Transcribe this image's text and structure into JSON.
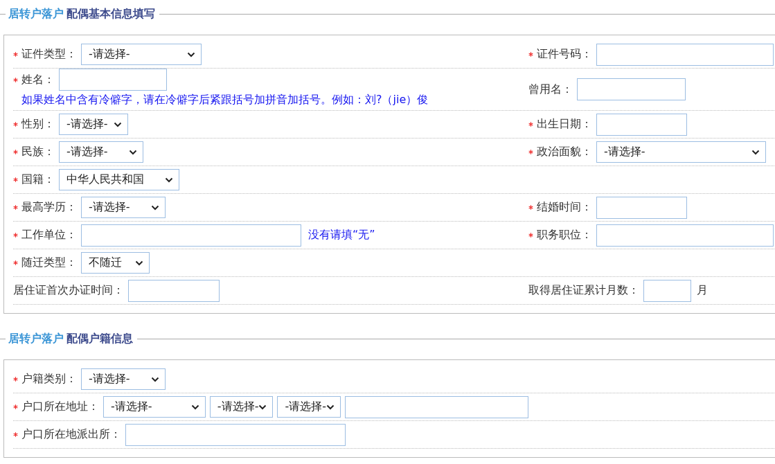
{
  "sections": [
    {
      "prefix": "居转户落户",
      "title": "配偶基本信息填写",
      "rows": [
        {
          "left": {
            "required": true,
            "label": "证件类型：",
            "controls": [
              {
                "kind": "select",
                "value": "-请选择-"
              }
            ]
          },
          "right": {
            "required": true,
            "label": "证件号码：",
            "controls": [
              {
                "kind": "input"
              }
            ]
          }
        },
        {
          "left": {
            "required": true,
            "label": "姓名：",
            "controls": [
              {
                "kind": "input"
              }
            ],
            "note": "如果姓名中含有冷僻字，请在冷僻字后紧跟括号加拼音加括号。例如：刘?（jie）俊"
          },
          "right": {
            "required": false,
            "label": "曾用名：",
            "controls": [
              {
                "kind": "input"
              }
            ]
          }
        },
        {
          "left": {
            "required": true,
            "label": "性别：",
            "controls": [
              {
                "kind": "select",
                "value": "-请选择-"
              }
            ]
          },
          "right": {
            "required": true,
            "label": "出生日期：",
            "controls": [
              {
                "kind": "input"
              }
            ]
          }
        },
        {
          "left": {
            "required": true,
            "label": "民族：",
            "controls": [
              {
                "kind": "select",
                "value": "-请选择-"
              }
            ]
          },
          "right": {
            "required": true,
            "label": "政治面貌：",
            "controls": [
              {
                "kind": "select",
                "value": "-请选择-"
              }
            ]
          }
        },
        {
          "left": {
            "required": true,
            "label": "国籍：",
            "controls": [
              {
                "kind": "select",
                "value": "中华人民共和国"
              }
            ]
          }
        },
        {
          "left": {
            "required": true,
            "label": "最高学历：",
            "controls": [
              {
                "kind": "select",
                "value": "-请选择-"
              }
            ]
          },
          "right": {
            "required": true,
            "label": "结婚时间：",
            "controls": [
              {
                "kind": "input"
              }
            ]
          }
        },
        {
          "left": {
            "required": true,
            "label": "工作单位：",
            "controls": [
              {
                "kind": "input"
              },
              {
                "kind": "hint",
                "text": "没有请填“无”"
              }
            ]
          },
          "right": {
            "required": true,
            "label": "职务职位：",
            "controls": [
              {
                "kind": "input"
              }
            ]
          }
        },
        {
          "left": {
            "required": true,
            "label": "随迁类型：",
            "controls": [
              {
                "kind": "select",
                "value": "不随迁"
              }
            ]
          }
        },
        {
          "left": {
            "required": false,
            "label": "居住证首次办证时间：",
            "controls": [
              {
                "kind": "input"
              }
            ]
          },
          "right": {
            "required": false,
            "label": "取得居住证累计月数：",
            "controls": [
              {
                "kind": "input"
              },
              {
                "kind": "unit",
                "text": "月"
              }
            ]
          }
        }
      ]
    },
    {
      "prefix": "居转户落户",
      "title": "配偶户籍信息",
      "rows": [
        {
          "left": {
            "required": true,
            "label": "户籍类别：",
            "controls": [
              {
                "kind": "select",
                "value": "-请选择-"
              }
            ]
          }
        },
        {
          "left": {
            "required": true,
            "label": "户口所在地址：",
            "controls": [
              {
                "kind": "select",
                "value": "-请选择-"
              },
              {
                "kind": "select",
                "value": "-请选择-"
              },
              {
                "kind": "select",
                "value": "-请选择-"
              },
              {
                "kind": "input"
              }
            ]
          }
        },
        {
          "left": {
            "required": true,
            "label": "户口所在地派出所：",
            "controls": [
              {
                "kind": "input"
              }
            ]
          }
        }
      ]
    }
  ]
}
